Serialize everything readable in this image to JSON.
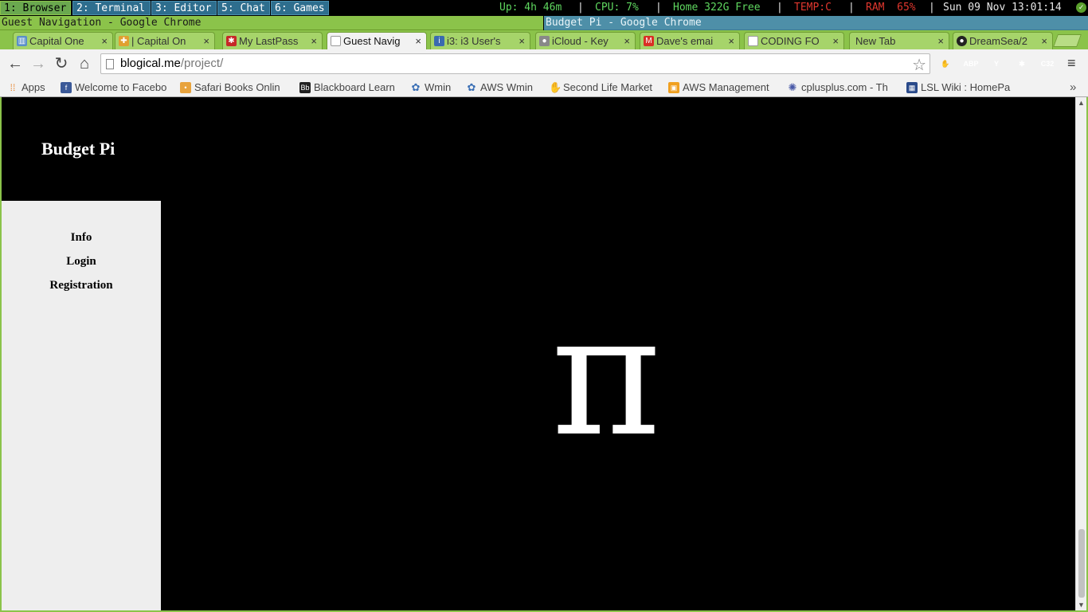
{
  "i3bar": {
    "workspaces": [
      "1: Browser",
      "2: Terminal",
      "3: Editor",
      "5: Chat",
      "6: Games"
    ],
    "status": {
      "uptime": "Up: 4h 46m",
      "cpu": "CPU: 7%",
      "home": "Home 322G Free",
      "temp": "TEMP:C",
      "ram": "RAM  65%",
      "datetime": "Sun 09 Nov 13:01:14",
      "separator": "|"
    }
  },
  "window_titles": {
    "left": "Guest Navigation - Google Chrome",
    "right": "Budget Pi - Google Chrome"
  },
  "tabs": [
    {
      "label": "Capital One",
      "icon": "trello-icon"
    },
    {
      "label": "| Capital On",
      "icon": "puzzle-icon"
    },
    {
      "label": "My LastPass",
      "icon": "lastpass-icon"
    },
    {
      "label": "Guest Navig",
      "icon": "page-icon"
    },
    {
      "label": "i3: i3 User's",
      "icon": "i3-icon"
    },
    {
      "label": "iCloud - Key",
      "icon": "apple-icon"
    },
    {
      "label": "Dave's emai",
      "icon": "gmail-icon"
    },
    {
      "label": "CODING FO",
      "icon": "page-icon"
    },
    {
      "label": "New Tab",
      "icon": ""
    },
    {
      "label": "DreamSea/2",
      "icon": "github-icon"
    }
  ],
  "tab_close_glyph": "×",
  "toolbar": {
    "url_host": "blogical.me",
    "url_path": "/project/",
    "extensions": [
      {
        "name": "adblock-stop",
        "text": "✋",
        "color": "#d32f2f"
      },
      {
        "name": "adblock-plus",
        "text": "ABP",
        "color": "#e53935"
      },
      {
        "name": "y-extension",
        "text": "Y",
        "color": "#8e44ad"
      },
      {
        "name": "lastpass",
        "text": "✱",
        "color": "#c62828"
      },
      {
        "name": "c32",
        "text": "C32",
        "color": "#b71c1c"
      }
    ]
  },
  "bookmarks": [
    {
      "label": "Apps",
      "icon": "apps-icon",
      "color": "#e67e22"
    },
    {
      "label": "Welcome to Facebo",
      "icon": "facebook-icon",
      "color": "#3b5998"
    },
    {
      "label": "Safari Books Onlin",
      "icon": "safari-books-icon",
      "color": "#e8a33d"
    },
    {
      "label": "Blackboard Learn",
      "icon": "blackboard-icon",
      "color": "#222222"
    },
    {
      "label": "Wmin",
      "icon": "wmin-icon",
      "color": "#3a6fb5"
    },
    {
      "label": "AWS Wmin",
      "icon": "aws-wmin-icon",
      "color": "#3a6fb5"
    },
    {
      "label": "Second Life Market",
      "icon": "second-life-icon",
      "color": "#5a8a3a"
    },
    {
      "label": "AWS Management",
      "icon": "aws-icon",
      "color": "#f0a020"
    },
    {
      "label": "cplusplus.com - Th",
      "icon": "cplusplus-icon",
      "color": "#4a5aa8"
    },
    {
      "label": "LSL Wiki : HomePa",
      "icon": "lsl-wiki-icon",
      "color": "#2a4a8a"
    }
  ],
  "bookmarks_more": "»",
  "page": {
    "title": "Budget Pi",
    "nav": [
      "Info",
      "Login",
      "Registration"
    ],
    "hero_symbol": "π"
  }
}
